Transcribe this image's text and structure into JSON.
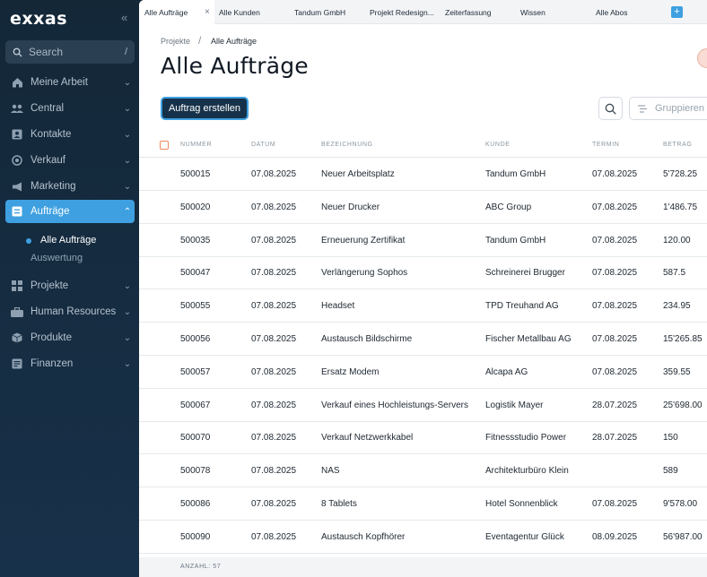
{
  "sidebar": {
    "logo": "exxas",
    "collapse_icon": "«",
    "search": {
      "label": "Search",
      "shortcut": "/"
    },
    "items": [
      {
        "label": "Meine Arbeit",
        "icon": "home-icon"
      },
      {
        "label": "Central",
        "icon": "people-icon"
      },
      {
        "label": "Kontakte",
        "icon": "contacts-icon"
      },
      {
        "label": "Verkauf",
        "icon": "target-icon"
      },
      {
        "label": "Marketing",
        "icon": "megaphone-icon"
      },
      {
        "label": "Aufträge",
        "icon": "orders-icon",
        "active": true
      },
      {
        "label": "Projekte",
        "icon": "projects-icon"
      },
      {
        "label": "Human Resources",
        "icon": "hr-icon"
      },
      {
        "label": "Produkte",
        "icon": "box-icon"
      },
      {
        "label": "Finanzen",
        "icon": "finance-icon"
      }
    ],
    "sub_items": [
      {
        "label": "Alle Aufträge",
        "active": true
      },
      {
        "label": "Auswertung",
        "active": false
      }
    ]
  },
  "tabs": {
    "items": [
      {
        "label": "Alle Aufträge",
        "active": true
      },
      {
        "label": "Alle Kunden"
      },
      {
        "label": "Tandum GmbH"
      },
      {
        "label": "Projekt Redesign..."
      },
      {
        "label": "Zeiterfassung"
      },
      {
        "label": "Wissen"
      },
      {
        "label": "Alle Abos"
      }
    ],
    "close_glyph": "×",
    "add_glyph": "+"
  },
  "breadcrumb": {
    "parent": "Projekte",
    "separator": "/",
    "current": "Alle Aufträge"
  },
  "page_title": "Alle Aufträge",
  "toolbar": {
    "create_label": "Auftrag erstellen",
    "group_label": "Gruppieren"
  },
  "table": {
    "columns": [
      "NUMMER",
      "DATUM",
      "BEZEICHNUNG",
      "KUNDE",
      "TERMIN",
      "BETRAG"
    ],
    "rows": [
      [
        "500015",
        "07.08.2025",
        "Neuer Arbeitsplatz",
        "Tandum GmbH",
        "07.08.2025",
        "5'728.25"
      ],
      [
        "500020",
        "07.08.2025",
        "Neuer Drucker",
        "ABC Group",
        "07.08.2025",
        "1'486.75"
      ],
      [
        "500035",
        "07.08.2025",
        "Erneuerung Zertifikat",
        "Tandum GmbH",
        "07.08.2025",
        "120.00"
      ],
      [
        "500047",
        "07.08.2025",
        "Verlängerung Sophos",
        "Schreinerei Brugger",
        "07.08.2025",
        "587.5"
      ],
      [
        "500055",
        "07.08.2025",
        "Headset",
        "TPD Treuhand AG",
        "07.08.2025",
        "234.95"
      ],
      [
        "500056",
        "07.08.2025",
        "Austausch Bildschirme",
        "Fischer Metallbau AG",
        "07.08.2025",
        "15'265.85"
      ],
      [
        "500057",
        "07.08.2025",
        "Ersatz Modem",
        "Alcapa AG",
        "07.08.2025",
        "359.55"
      ],
      [
        "500067",
        "07.08.2025",
        "Verkauf eines Hochleistungs-Servers",
        "Logistik Mayer",
        "28.07.2025",
        "25'698.00"
      ],
      [
        "500070",
        "07.08.2025",
        "Verkauf Netzwerkkabel",
        "Fitnessstudio Power",
        "28.07.2025",
        "150"
      ],
      [
        "500078",
        "07.08.2025",
        "NAS",
        "Architekturbüro Klein",
        "",
        "589"
      ],
      [
        "500086",
        "07.08.2025",
        "8 Tablets",
        "Hotel Sonnenblick",
        "07.08.2025",
        "9'578.00"
      ],
      [
        "500090",
        "07.08.2025",
        "Austausch Kopfhörer",
        "Eventagentur Glück",
        "08.09.2025",
        "56'987.00"
      ]
    ]
  },
  "footer": {
    "count_label": "ANZAHL: 57"
  },
  "colors": {
    "accent": "#3ea0e0",
    "sidebar_bg": "#132737",
    "checkbox": "#ef8a5a"
  }
}
